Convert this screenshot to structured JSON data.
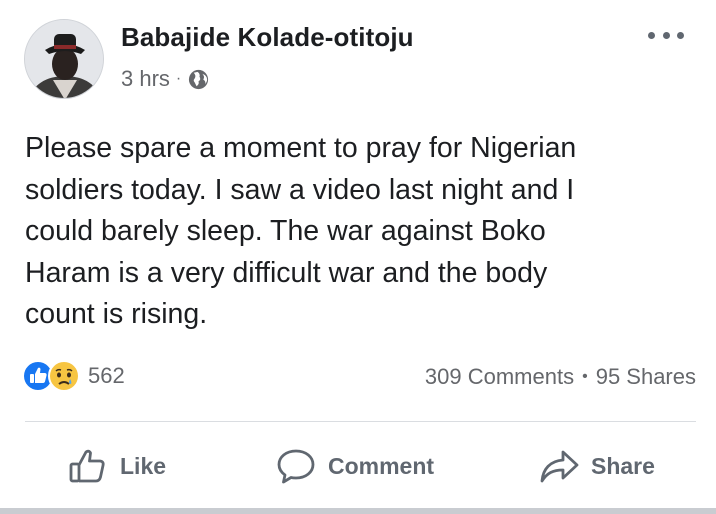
{
  "post": {
    "author": "Babajide Kolade-otitoju",
    "time": "3 hrs",
    "separator": "·",
    "privacy_icon": "globe-icon",
    "text": "Please spare a moment to pray for Nigerian\nsoldiers today.  I saw a video last night and I\ncould barely sleep. The war against Boko\nHaram is a very difficult war and the body\ncount is rising."
  },
  "reactions": {
    "icons": [
      "like-reaction-icon",
      "sad-reaction-icon"
    ],
    "count": "562"
  },
  "stats": {
    "comments": "309 Comments",
    "separator": "•",
    "shares": "95 Shares"
  },
  "actions": {
    "like": "Like",
    "comment": "Comment",
    "share": "Share"
  },
  "colors": {
    "text": "#1c1e21",
    "secondary": "#65676b",
    "like_blue": "#1877f2",
    "sad_yellow": "#f7c542",
    "divider": "#dadde1"
  }
}
